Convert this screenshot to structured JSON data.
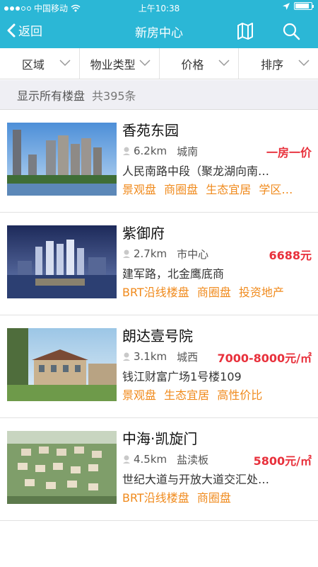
{
  "status_bar": {
    "carrier": "中国移动",
    "time": "上午10:38"
  },
  "nav": {
    "back_label": "返回",
    "title": "新房中心",
    "map_icon": "map-icon",
    "search_icon": "search-icon"
  },
  "filters": [
    {
      "label": "区域"
    },
    {
      "label": "物业类型"
    },
    {
      "label": "价格"
    },
    {
      "label": "排序"
    }
  ],
  "summary": {
    "label": "显示所有楼盘",
    "count": "共395条"
  },
  "listings": [
    {
      "name": "香苑东园",
      "distance": "6.2km",
      "area": "城南",
      "price": "一房一价",
      "address": "人民南路中段（聚龙湖向南…",
      "tags": [
        "景观盘",
        "商圈盘",
        "生态宜居",
        "学区…"
      ]
    },
    {
      "name": "紫御府",
      "distance": "2.7km",
      "area": "市中心",
      "price": "6688元",
      "address": "建军路，北金鹰底商",
      "tags": [
        "BRT沿线楼盘",
        "商圈盘",
        "投资地产"
      ]
    },
    {
      "name": "朗达壹号院",
      "distance": "3.1km",
      "area": "城西",
      "price": "7000-8000元/㎡",
      "address": "钱江财富广场1号楼109",
      "tags": [
        "景观盘",
        "生态宜居",
        "高性价比"
      ]
    },
    {
      "name": "中海·凯旋门",
      "distance": "4.5km",
      "area": "盐渎板",
      "price": "5800元/㎡",
      "address": "世纪大道与开放大道交汇处…",
      "tags": [
        "BRT沿线楼盘",
        "商圈盘"
      ]
    }
  ],
  "colors": {
    "header": "#2bb7d6",
    "price": "#e8313c",
    "tag": "#f08a1c"
  }
}
